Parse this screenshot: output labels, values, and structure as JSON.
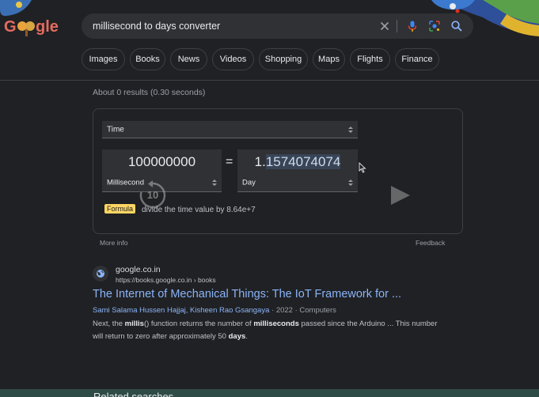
{
  "header": {
    "logo_text": "Google",
    "search": {
      "value": "millisecond to days converter",
      "clear_icon": "close-icon",
      "voice_icon": "mic-icon",
      "lens_icon": "camera-lens-icon",
      "search_icon": "search-icon"
    },
    "chips": [
      "Images",
      "Books",
      "News",
      "Videos",
      "Shopping",
      "Maps",
      "Flights",
      "Finance"
    ]
  },
  "result_stats": "About 0 results (0.30 seconds)",
  "converter": {
    "category": "Time",
    "equals": "=",
    "from": {
      "value": "100000000",
      "unit": "Millisecond"
    },
    "to": {
      "value_prefix": "1.",
      "value_selected": "1574074074",
      "unit": "Day"
    },
    "formula_label": "Formula",
    "formula_text": "divide the time value by 8.64e+7",
    "more_info": "More info",
    "feedback": "Feedback",
    "overlay": {
      "replay_label": "10",
      "replay_icon": "replay-10-icon",
      "play_icon": "play-icon"
    }
  },
  "result": {
    "site_name": "google.co.in",
    "site_url": "https://books.google.co.in › books",
    "title": "The Internet of Mechanical Things: The IoT Framework for ...",
    "authors": "Sami Salama Hussen Hajjaj, Kisheen Rao Gsangaya",
    "meta": " · 2022 · Computers",
    "snippet": {
      "p1": "Next, the ",
      "b1": "millis",
      "p2": "() function returns the number of ",
      "b2": "milliseconds",
      "p3": " passed since the Arduino ... This number will return to zero after approximately 50 ",
      "b3": "days",
      "p4": "."
    }
  },
  "bottom": {
    "partial_text": "Related searches"
  },
  "colors": {
    "background": "#202124",
    "link": "#8ab4f8",
    "formula_badge": "#fdd663",
    "selection": "#394457"
  }
}
